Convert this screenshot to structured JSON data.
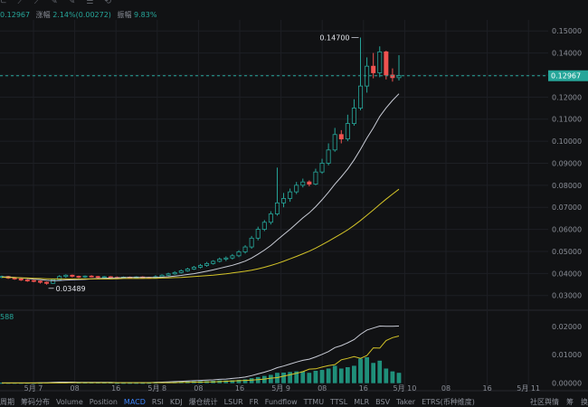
{
  "header": {
    "toolbar_icons": [
      "⊂",
      "⟋",
      "⟋",
      "✎",
      "✎",
      "☰",
      "⟲"
    ],
    "ohlc_close": "0.12967",
    "change_label": "涨幅",
    "change_value": "2.14%(0.00272)",
    "amplitude_label": "振幅",
    "amplitude_value": "9.83%"
  },
  "indicator_label": "588",
  "tabs": [
    "周期",
    "筹码分布",
    "Volume",
    "Position",
    "MACD",
    "RSI",
    "KDJ",
    "爆仓统计",
    "LSUR",
    "FR",
    "Fundflow",
    "TTMU",
    "TTSL",
    "MLR",
    "BSV",
    "Taker",
    "ETRS(币种维度)"
  ],
  "active_tab": "MACD",
  "right_tabs": [
    "社区舆情",
    "筹",
    "换"
  ],
  "colors": {
    "bg": "#111214",
    "up": "#26a69a",
    "down": "#ef5350",
    "ma_fast": "#c9ccd6",
    "ma_slow": "#d4c428",
    "current_price_line": "#26a69a",
    "grid": "#1d1f24"
  },
  "chart_data": [
    {
      "type": "candlestick",
      "x_ticks": [
        "5月 7",
        "08",
        "16",
        "5月 8",
        "08",
        "16",
        "5月 9",
        "08",
        "16",
        "5月 10",
        "08",
        "16",
        "5月 11"
      ],
      "y_ticks": [
        "0.15000",
        "0.14000",
        "0.13000",
        "0.12000",
        "0.11000",
        "0.10000",
        "0.09000",
        "0.08000",
        "0.07000",
        "0.06000",
        "0.05000",
        "0.04000",
        "0.03000"
      ],
      "ylim": [
        0.027,
        0.155
      ],
      "current_price": "0.12967",
      "high_annotation": "0.14700",
      "low_annotation": "0.03489",
      "candles": [
        [
          0.0382,
          0.0386,
          0.039,
          0.0378
        ],
        [
          0.0386,
          0.0379,
          0.0389,
          0.0375
        ],
        [
          0.0379,
          0.0375,
          0.0383,
          0.0371
        ],
        [
          0.0375,
          0.037,
          0.0378,
          0.0366
        ],
        [
          0.037,
          0.0368,
          0.0374,
          0.0362
        ],
        [
          0.0368,
          0.0365,
          0.0371,
          0.036
        ],
        [
          0.0365,
          0.036,
          0.0368,
          0.0354
        ],
        [
          0.036,
          0.0355,
          0.0363,
          0.0349
        ],
        [
          0.0355,
          0.0372,
          0.0376,
          0.0353
        ],
        [
          0.0372,
          0.0386,
          0.0392,
          0.037
        ],
        [
          0.0386,
          0.0392,
          0.0396,
          0.038
        ],
        [
          0.0392,
          0.0387,
          0.0395,
          0.0382
        ],
        [
          0.0387,
          0.0384,
          0.039,
          0.0379
        ],
        [
          0.0384,
          0.0388,
          0.0391,
          0.038
        ],
        [
          0.0388,
          0.0386,
          0.0392,
          0.0382
        ],
        [
          0.0386,
          0.0383,
          0.0389,
          0.0378
        ],
        [
          0.0383,
          0.0385,
          0.0388,
          0.0379
        ],
        [
          0.0385,
          0.0382,
          0.0388,
          0.0378
        ],
        [
          0.0382,
          0.038,
          0.0386,
          0.0377
        ],
        [
          0.038,
          0.0383,
          0.0386,
          0.0377
        ],
        [
          0.0383,
          0.0381,
          0.0386,
          0.0377
        ],
        [
          0.0381,
          0.0384,
          0.0387,
          0.0378
        ],
        [
          0.0384,
          0.0382,
          0.0387,
          0.0379
        ],
        [
          0.0382,
          0.038,
          0.0385,
          0.0376
        ],
        [
          0.038,
          0.0385,
          0.0392,
          0.0378
        ],
        [
          0.0385,
          0.0392,
          0.0396,
          0.0382
        ],
        [
          0.0392,
          0.0398,
          0.0403,
          0.0388
        ],
        [
          0.0398,
          0.0404,
          0.041,
          0.0394
        ],
        [
          0.0404,
          0.0412,
          0.0418,
          0.04
        ],
        [
          0.0412,
          0.042,
          0.0426,
          0.0408
        ],
        [
          0.042,
          0.0428,
          0.0434,
          0.0416
        ],
        [
          0.0428,
          0.0436,
          0.0443,
          0.0423
        ],
        [
          0.0436,
          0.0445,
          0.0452,
          0.043
        ],
        [
          0.0445,
          0.0455,
          0.046,
          0.044
        ],
        [
          0.0455,
          0.0465,
          0.0472,
          0.045
        ],
        [
          0.0465,
          0.047,
          0.0477,
          0.0456
        ],
        [
          0.047,
          0.048,
          0.0488,
          0.0463
        ],
        [
          0.048,
          0.0498,
          0.0505,
          0.0474
        ],
        [
          0.0498,
          0.052,
          0.0528,
          0.049
        ],
        [
          0.052,
          0.056,
          0.057,
          0.0512
        ],
        [
          0.056,
          0.06,
          0.0612,
          0.055
        ],
        [
          0.06,
          0.0632,
          0.0642,
          0.0592
        ],
        [
          0.0632,
          0.067,
          0.0682,
          0.0622
        ],
        [
          0.067,
          0.072,
          0.088,
          0.0662
        ],
        [
          0.072,
          0.074,
          0.0765,
          0.07
        ],
        [
          0.074,
          0.077,
          0.0785,
          0.0725
        ],
        [
          0.077,
          0.08,
          0.0815,
          0.076
        ],
        [
          0.08,
          0.0815,
          0.083,
          0.079
        ],
        [
          0.0815,
          0.0805,
          0.0822,
          0.0795
        ],
        [
          0.0805,
          0.086,
          0.0875,
          0.08
        ],
        [
          0.086,
          0.09,
          0.092,
          0.0852
        ],
        [
          0.09,
          0.096,
          0.099,
          0.089
        ],
        [
          0.096,
          0.103,
          0.106,
          0.0952
        ],
        [
          0.103,
          0.101,
          0.105,
          0.099
        ],
        [
          0.101,
          0.108,
          0.112,
          0.1
        ],
        [
          0.108,
          0.115,
          0.119,
          0.107
        ],
        [
          0.115,
          0.125,
          0.147,
          0.114
        ],
        [
          0.125,
          0.134,
          0.138,
          0.122
        ],
        [
          0.134,
          0.131,
          0.14,
          0.1285
        ],
        [
          0.131,
          0.1405,
          0.143,
          0.129
        ],
        [
          0.1405,
          0.13,
          0.141,
          0.128
        ],
        [
          0.13,
          0.1288,
          0.133,
          0.127
        ],
        [
          0.1288,
          0.1297,
          0.139,
          0.1275
        ]
      ],
      "series": [
        {
          "values": [
            0.0384,
            0.0384,
            0.0382,
            0.038,
            0.0377,
            0.0374,
            0.0372,
            0.0369,
            0.0367,
            0.0368,
            0.037,
            0.0371,
            0.0372,
            0.0373,
            0.0375,
            0.0377,
            0.0378,
            0.0379,
            0.038,
            0.0381,
            0.0382,
            0.0382,
            0.0382,
            0.0382,
            0.0382,
            0.0383,
            0.0385,
            0.0388,
            0.0391,
            0.0395,
            0.0399,
            0.0404,
            0.041,
            0.0416,
            0.0423,
            0.043,
            0.0437,
            0.0446,
            0.0456,
            0.047,
            0.0487,
            0.0506,
            0.0527,
            0.0552,
            0.0576,
            0.06,
            0.0626,
            0.0652,
            0.0675,
            0.0703,
            0.0734,
            0.0768,
            0.0805,
            0.0838,
            0.0874,
            0.0915,
            0.0963,
            0.1014,
            0.106,
            0.1112,
            0.1151,
            0.1185,
            0.1215
          ]
        },
        {
          "values": [
            0.0383,
            0.0382,
            0.0381,
            0.038,
            0.0379,
            0.0378,
            0.0377,
            0.0376,
            0.0375,
            0.0375,
            0.0375,
            0.0375,
            0.0375,
            0.0375,
            0.0375,
            0.0375,
            0.0375,
            0.0375,
            0.0376,
            0.0377,
            0.0377,
            0.0377,
            0.0377,
            0.0378,
            0.0378,
            0.0379,
            0.038,
            0.0381,
            0.0382,
            0.0384,
            0.0386,
            0.0388,
            0.039,
            0.0392,
            0.0395,
            0.0398,
            0.0402,
            0.0406,
            0.041,
            0.0415,
            0.0421,
            0.0428,
            0.0436,
            0.0445,
            0.0455,
            0.0466,
            0.0477,
            0.0489,
            0.0501,
            0.0515,
            0.053,
            0.0546,
            0.0563,
            0.058,
            0.0598,
            0.0618,
            0.064,
            0.0664,
            0.0688,
            0.0713,
            0.0737,
            0.076,
            0.0782
          ]
        }
      ]
    },
    {
      "type": "bar",
      "y_ticks": [
        "0.02000",
        "0.01000",
        "0.00000"
      ],
      "ylim": [
        -0.0005,
        0.0225
      ],
      "histogram": [
        0.0,
        0.0,
        0.0,
        0.0,
        0.0,
        0.0,
        0.0,
        0.0001,
        0.0002,
        0.0003,
        0.0003,
        0.0002,
        0.0001,
        0.0001,
        0.0001,
        0.0001,
        0.0001,
        0.0001,
        0.0,
        0.0,
        0.0,
        0.0,
        0.0,
        0.0,
        0.0001,
        0.0002,
        0.0003,
        0.0004,
        0.0004,
        0.0005,
        0.0005,
        0.0006,
        0.0006,
        0.0007,
        0.0008,
        0.0008,
        0.0009,
        0.001,
        0.0012,
        0.0016,
        0.002,
        0.0024,
        0.0028,
        0.0035,
        0.0036,
        0.0038,
        0.004,
        0.004,
        0.0035,
        0.0042,
        0.0045,
        0.005,
        0.006,
        0.005,
        0.0055,
        0.006,
        0.0085,
        0.009,
        0.007,
        0.0078,
        0.005,
        0.004,
        0.0035
      ],
      "series": [
        {
          "values": [
            0.0,
            0.0,
            0.0,
            0.0,
            0.0,
            0.0,
            0.0001,
            0.0001,
            0.0002,
            0.0003,
            0.0003,
            0.0003,
            0.0002,
            0.0002,
            0.0002,
            0.0002,
            0.0002,
            0.0002,
            0.0001,
            0.0001,
            0.0001,
            0.0001,
            0.0001,
            0.0001,
            0.0002,
            0.0003,
            0.0004,
            0.0005,
            0.0006,
            0.0007,
            0.0008,
            0.0009,
            0.001,
            0.0011,
            0.0013,
            0.0014,
            0.0016,
            0.0018,
            0.0021,
            0.0026,
            0.0032,
            0.0038,
            0.0045,
            0.0054,
            0.006,
            0.0067,
            0.0074,
            0.008,
            0.0084,
            0.0092,
            0.0101,
            0.0111,
            0.0125,
            0.0132,
            0.0142,
            0.0153,
            0.0172,
            0.0187,
            0.0194,
            0.0201,
            0.02,
            0.02,
            0.0201
          ]
        },
        {
          "values": [
            0.0,
            0.0,
            0.0,
            0.0,
            0.0,
            0.0,
            0.0,
            0.0,
            0.0,
            0.0,
            0.0,
            0.0001,
            0.0001,
            0.0001,
            0.0001,
            0.0001,
            0.0001,
            0.0001,
            0.0001,
            0.0001,
            0.0001,
            0.0001,
            0.0001,
            0.0001,
            0.0001,
            0.0001,
            0.0001,
            0.0001,
            0.0002,
            0.0002,
            0.0003,
            0.0003,
            0.0004,
            0.0004,
            0.0005,
            0.0006,
            0.0007,
            0.0008,
            0.0009,
            0.001,
            0.0012,
            0.0014,
            0.0017,
            0.0019,
            0.0024,
            0.0029,
            0.0034,
            0.004,
            0.0049,
            0.005,
            0.0056,
            0.0061,
            0.0065,
            0.0082,
            0.0087,
            0.0093,
            0.0087,
            0.0097,
            0.0124,
            0.0123,
            0.015,
            0.016,
            0.0166
          ]
        }
      ]
    }
  ]
}
